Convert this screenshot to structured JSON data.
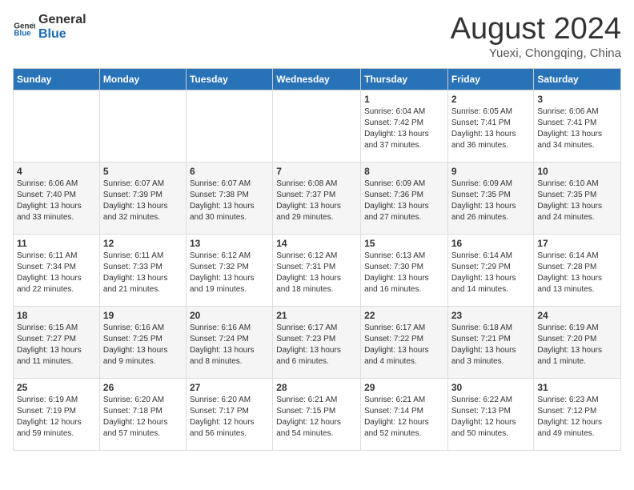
{
  "header": {
    "logo_general": "General",
    "logo_blue": "Blue",
    "month_year": "August 2024",
    "location": "Yuexi, Chongqing, China"
  },
  "weekdays": [
    "Sunday",
    "Monday",
    "Tuesday",
    "Wednesday",
    "Thursday",
    "Friday",
    "Saturday"
  ],
  "weeks": [
    [
      {
        "day": "",
        "info": ""
      },
      {
        "day": "",
        "info": ""
      },
      {
        "day": "",
        "info": ""
      },
      {
        "day": "",
        "info": ""
      },
      {
        "day": "1",
        "info": "Sunrise: 6:04 AM\nSunset: 7:42 PM\nDaylight: 13 hours\nand 37 minutes."
      },
      {
        "day": "2",
        "info": "Sunrise: 6:05 AM\nSunset: 7:41 PM\nDaylight: 13 hours\nand 36 minutes."
      },
      {
        "day": "3",
        "info": "Sunrise: 6:06 AM\nSunset: 7:41 PM\nDaylight: 13 hours\nand 34 minutes."
      }
    ],
    [
      {
        "day": "4",
        "info": "Sunrise: 6:06 AM\nSunset: 7:40 PM\nDaylight: 13 hours\nand 33 minutes."
      },
      {
        "day": "5",
        "info": "Sunrise: 6:07 AM\nSunset: 7:39 PM\nDaylight: 13 hours\nand 32 minutes."
      },
      {
        "day": "6",
        "info": "Sunrise: 6:07 AM\nSunset: 7:38 PM\nDaylight: 13 hours\nand 30 minutes."
      },
      {
        "day": "7",
        "info": "Sunrise: 6:08 AM\nSunset: 7:37 PM\nDaylight: 13 hours\nand 29 minutes."
      },
      {
        "day": "8",
        "info": "Sunrise: 6:09 AM\nSunset: 7:36 PM\nDaylight: 13 hours\nand 27 minutes."
      },
      {
        "day": "9",
        "info": "Sunrise: 6:09 AM\nSunset: 7:35 PM\nDaylight: 13 hours\nand 26 minutes."
      },
      {
        "day": "10",
        "info": "Sunrise: 6:10 AM\nSunset: 7:35 PM\nDaylight: 13 hours\nand 24 minutes."
      }
    ],
    [
      {
        "day": "11",
        "info": "Sunrise: 6:11 AM\nSunset: 7:34 PM\nDaylight: 13 hours\nand 22 minutes."
      },
      {
        "day": "12",
        "info": "Sunrise: 6:11 AM\nSunset: 7:33 PM\nDaylight: 13 hours\nand 21 minutes."
      },
      {
        "day": "13",
        "info": "Sunrise: 6:12 AM\nSunset: 7:32 PM\nDaylight: 13 hours\nand 19 minutes."
      },
      {
        "day": "14",
        "info": "Sunrise: 6:12 AM\nSunset: 7:31 PM\nDaylight: 13 hours\nand 18 minutes."
      },
      {
        "day": "15",
        "info": "Sunrise: 6:13 AM\nSunset: 7:30 PM\nDaylight: 13 hours\nand 16 minutes."
      },
      {
        "day": "16",
        "info": "Sunrise: 6:14 AM\nSunset: 7:29 PM\nDaylight: 13 hours\nand 14 minutes."
      },
      {
        "day": "17",
        "info": "Sunrise: 6:14 AM\nSunset: 7:28 PM\nDaylight: 13 hours\nand 13 minutes."
      }
    ],
    [
      {
        "day": "18",
        "info": "Sunrise: 6:15 AM\nSunset: 7:27 PM\nDaylight: 13 hours\nand 11 minutes."
      },
      {
        "day": "19",
        "info": "Sunrise: 6:16 AM\nSunset: 7:25 PM\nDaylight: 13 hours\nand 9 minutes."
      },
      {
        "day": "20",
        "info": "Sunrise: 6:16 AM\nSunset: 7:24 PM\nDaylight: 13 hours\nand 8 minutes."
      },
      {
        "day": "21",
        "info": "Sunrise: 6:17 AM\nSunset: 7:23 PM\nDaylight: 13 hours\nand 6 minutes."
      },
      {
        "day": "22",
        "info": "Sunrise: 6:17 AM\nSunset: 7:22 PM\nDaylight: 13 hours\nand 4 minutes."
      },
      {
        "day": "23",
        "info": "Sunrise: 6:18 AM\nSunset: 7:21 PM\nDaylight: 13 hours\nand 3 minutes."
      },
      {
        "day": "24",
        "info": "Sunrise: 6:19 AM\nSunset: 7:20 PM\nDaylight: 13 hours\nand 1 minute."
      }
    ],
    [
      {
        "day": "25",
        "info": "Sunrise: 6:19 AM\nSunset: 7:19 PM\nDaylight: 12 hours\nand 59 minutes."
      },
      {
        "day": "26",
        "info": "Sunrise: 6:20 AM\nSunset: 7:18 PM\nDaylight: 12 hours\nand 57 minutes."
      },
      {
        "day": "27",
        "info": "Sunrise: 6:20 AM\nSunset: 7:17 PM\nDaylight: 12 hours\nand 56 minutes."
      },
      {
        "day": "28",
        "info": "Sunrise: 6:21 AM\nSunset: 7:15 PM\nDaylight: 12 hours\nand 54 minutes."
      },
      {
        "day": "29",
        "info": "Sunrise: 6:21 AM\nSunset: 7:14 PM\nDaylight: 12 hours\nand 52 minutes."
      },
      {
        "day": "30",
        "info": "Sunrise: 6:22 AM\nSunset: 7:13 PM\nDaylight: 12 hours\nand 50 minutes."
      },
      {
        "day": "31",
        "info": "Sunrise: 6:23 AM\nSunset: 7:12 PM\nDaylight: 12 hours\nand 49 minutes."
      }
    ]
  ]
}
